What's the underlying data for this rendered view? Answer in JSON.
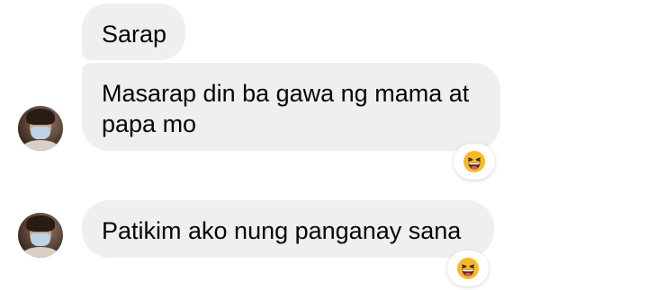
{
  "messages": [
    {
      "text": "Sarap"
    },
    {
      "text": "Masarap din ba gawa ng mama at papa mo",
      "reaction": "laughing-emoji"
    },
    {
      "text": "Patikim ako nung panganay sana",
      "reaction": "laughing-emoji"
    }
  ],
  "colors": {
    "bubble": "#efefef",
    "text": "#050505",
    "background": "#ffffff",
    "emoji_face": "#f7b928"
  }
}
